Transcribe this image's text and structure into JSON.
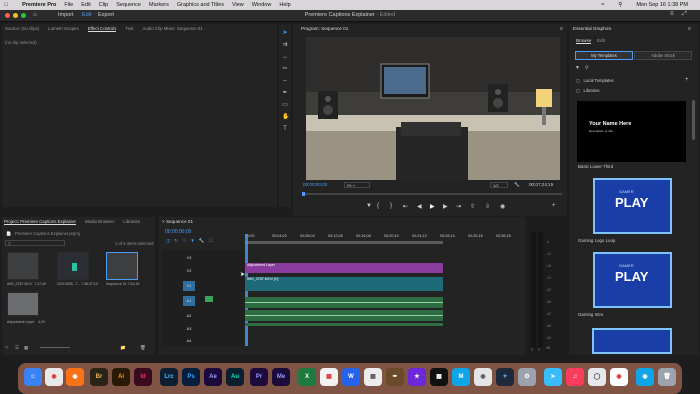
{
  "menubar": {
    "app_name": "Premiere Pro",
    "items": [
      "File",
      "Edit",
      "Clip",
      "Sequence",
      "Markers",
      "Graphics and Titles",
      "View",
      "Window",
      "Help"
    ],
    "clock": "Mon Sep 16  1:38 PM"
  },
  "titlebar": {
    "tabs": [
      "Import",
      "Edit",
      "Export"
    ],
    "active_tab": "Edit",
    "project_title": "Premiere Captions Explainer",
    "edited_label": " - Edited"
  },
  "source_panel": {
    "tabs": [
      "Source: (no clips)",
      "Lumetri Scopes",
      "Effect Controls",
      "Text",
      "Audio Clip Mixer: Sequence 01"
    ],
    "active_tab": "Effect Controls",
    "empty_label": "(no clip selected)"
  },
  "program_monitor": {
    "title": "Program: Sequence 01",
    "timecode_left": "00;00;00;00",
    "fit_label": "Fit",
    "quality": "1/2",
    "timecode_right": "00;07;24;15"
  },
  "project_panel": {
    "tabs": [
      "Project: Premiere Captions Explainer",
      "Media Browser",
      "Libraries"
    ],
    "active_tab": "Project: Premiere Captions Explainer",
    "file_name": "Premiere Captions Explainer.prproj",
    "selection_count": "1 of 4 items selected",
    "items": [
      {
        "name": "IMG_3787.MOV",
        "duration": "7;17;40"
      },
      {
        "name": "20210908...T...",
        "duration": "7;38;37;10"
      },
      {
        "name": "Sequence 01",
        "duration": "7;24;15"
      },
      {
        "name": "Adjustment Layer",
        "duration": "4;29"
      }
    ]
  },
  "timeline": {
    "title": "Sequence 01",
    "timecode": "00;00;00;00",
    "ruler": [
      "00;00",
      "00;04;02",
      "00;08;04",
      "00;12;06",
      "00;16;08",
      "00;20;10",
      "00;24;12",
      "00;28;14",
      "00;32;16",
      "00;36;18"
    ],
    "tracks": [
      "V3",
      "V2",
      "V1",
      "A1",
      "A2",
      "A3",
      "A4"
    ],
    "clips": {
      "adjustment": "Adjustment Layer",
      "video": "IMG_3787.MOV [V]"
    },
    "meter_ticks": [
      "-6",
      "-12",
      "-18",
      "-24",
      "-30",
      "-36",
      "-42",
      "-48",
      "-54",
      "dB"
    ],
    "meter_bottom": [
      "S",
      "S"
    ]
  },
  "graphics_panel": {
    "title": "Essential Graphics",
    "tabs": [
      "Browse",
      "Edit"
    ],
    "active_tab": "Browse",
    "subtabs": [
      "My Templates",
      "Adobe Stock"
    ],
    "active_subtab": "My Templates",
    "folders": [
      "Local Templates",
      "Libraries"
    ],
    "templates": [
      {
        "name": "Basic Lower Third",
        "line1": "Your Name Here",
        "line2": "Description or title"
      },
      {
        "name": "Gaming Logo Loop",
        "line1": "PLAY",
        "line2": "GAMER"
      },
      {
        "name": "Gaming Intro",
        "line1": "PLAY",
        "line2": "GAMER"
      }
    ]
  },
  "dock": {
    "labels": [
      "Br",
      "Ai",
      "Id",
      "Lrc",
      "Ps",
      "Ae",
      "Au",
      "Pr",
      "Me"
    ]
  },
  "colors": {
    "accent_blue": "#4b9cf5",
    "adjustment_clip": "#8a3c9e",
    "video_clip": "#1f6a78",
    "audio_clip": "#2e6c43"
  }
}
